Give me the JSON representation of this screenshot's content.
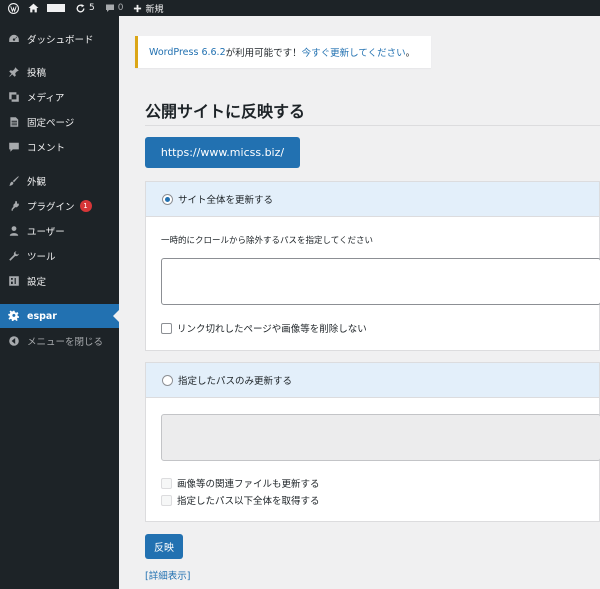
{
  "adminbar": {
    "update_count": "5",
    "comment_count": "0",
    "new_label": "新規"
  },
  "sidebar": {
    "items": [
      {
        "label": "ダッシュボード",
        "icon": "dashboard-icon"
      },
      {
        "label": "投稿",
        "icon": "pin-icon"
      },
      {
        "label": "メディア",
        "icon": "media-icon"
      },
      {
        "label": "固定ページ",
        "icon": "page-icon"
      },
      {
        "label": "コメント",
        "icon": "comment-icon"
      },
      {
        "label": "外観",
        "icon": "brush-icon"
      },
      {
        "label": "プラグイン",
        "icon": "plugin-icon",
        "badge": "1"
      },
      {
        "label": "ユーザー",
        "icon": "user-icon"
      },
      {
        "label": "ツール",
        "icon": "wrench-icon"
      },
      {
        "label": "設定",
        "icon": "settings-icon"
      },
      {
        "label": "espar",
        "icon": "gear-icon",
        "current": true
      },
      {
        "label": "メニューを閉じる",
        "icon": "collapse-icon"
      }
    ]
  },
  "notice": {
    "version_link": "WordPress 6.6.2",
    "text": " が利用可能です！",
    "update_link": "今すぐ更新してください",
    "end": "。"
  },
  "page": {
    "title": "公開サイトに反映する",
    "url_button": "https://www.micss.biz/",
    "apply_button": "反映",
    "detail_link": "[詳細表示]"
  },
  "panel_full": {
    "radio_label": "サイト全体を更新する",
    "exclude_label": "一時的にクロールから除外するパスを指定してください",
    "exclude_value": "",
    "checkbox_label": "リンク切れしたページや画像等を削除しない"
  },
  "panel_path": {
    "radio_label": "指定したパスのみ更新する",
    "path_value": "",
    "checkbox1_label": "画像等の関連ファイルも更新する",
    "checkbox2_label": "指定したパス以下全体を取得する"
  },
  "colors": {
    "accent": "#2271b1",
    "sidebar": "#1d2327",
    "notice_border": "#dba617",
    "badge": "#d63638"
  }
}
